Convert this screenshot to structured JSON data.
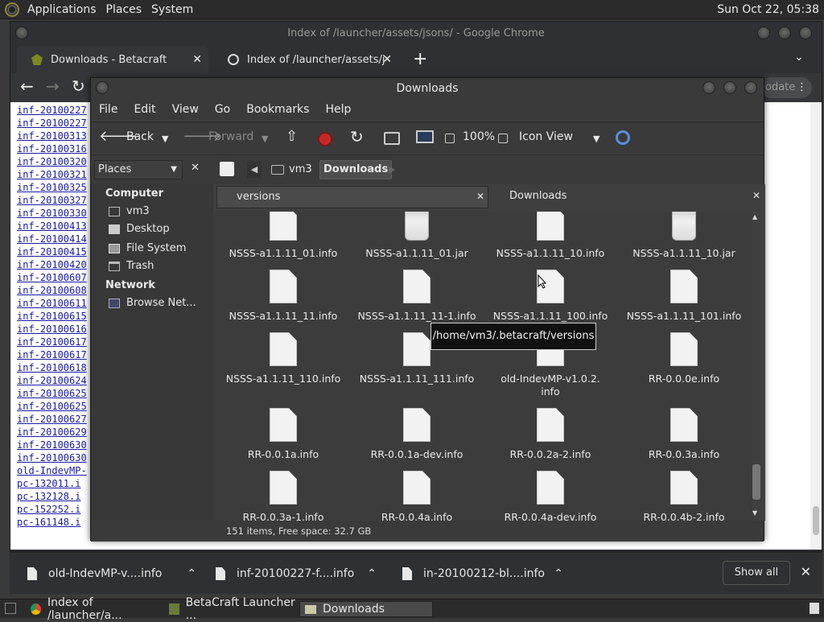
{
  "top_panel": {
    "menus": [
      "Applications",
      "Places",
      "System"
    ],
    "clock": "Sun Oct 22, 05:38"
  },
  "chrome": {
    "title": "Index of /launcher/assets/jsons/ - Google Chrome",
    "tabs": [
      {
        "label": "Downloads - Betacraft"
      },
      {
        "label": "Index of /launcher/assets/jsons"
      }
    ],
    "update_label": "odate",
    "links": [
      "inf-20100227",
      "inf-20100227",
      "inf-20100313",
      "inf-20100316",
      "inf-20100320",
      "inf-20100321",
      "inf-20100325",
      "inf-20100327",
      "inf-20100330",
      "inf-20100413",
      "inf-20100414",
      "inf-20100415",
      "inf-20100420",
      "inf-20100607",
      "inf-20100608",
      "inf-20100611",
      "inf-20100615",
      "inf-20100616",
      "inf-20100617",
      "inf-20100617",
      "inf-20100618",
      "inf-20100624",
      "inf-20100625",
      "inf-20100625",
      "inf-20100627",
      "inf-20100629",
      "inf-20100630",
      "inf-20100630",
      "old-IndevMP-",
      "pc-132011.i",
      "pc-132128.i",
      "pc-152252.i",
      "pc-161148.i"
    ]
  },
  "downloads_bar": {
    "items": [
      "old-IndevMP-v....info",
      "inf-20100227-f....info",
      "in-20100212-bl....info"
    ],
    "show_all": "Show all"
  },
  "taskbar": {
    "tasks": [
      "Index of /launcher/a...",
      "BetaCraft Launcher ...",
      "Downloads"
    ]
  },
  "nautilus": {
    "title": "Downloads",
    "menu": [
      "File",
      "Edit",
      "View",
      "Go",
      "Bookmarks",
      "Help"
    ],
    "toolbar": {
      "back": "Back",
      "forward": "Forward",
      "zoom": "100%",
      "view": "Icon View"
    },
    "sidebar_dropdown": "Places",
    "path": [
      "vm3",
      "Downloads"
    ],
    "sidebar": {
      "computer_heading": "Computer",
      "computer_items": [
        "vm3",
        "Desktop",
        "File System",
        "Trash"
      ],
      "network_heading": "Network",
      "network_items": [
        "Browse Net..."
      ]
    },
    "panes": [
      "versions",
      "Downloads"
    ],
    "tooltip": "/home/vm3/.betacraft/versions",
    "files": [
      {
        "name": "NSSS-a1.1.11_01.info",
        "type": "doc"
      },
      {
        "name": "NSSS-a1.1.11_01.jar",
        "type": "jar"
      },
      {
        "name": "NSSS-a1.1.11_10.info",
        "type": "doc"
      },
      {
        "name": "NSSS-a1.1.11_10.jar",
        "type": "jar"
      },
      {
        "name": "NSSS-a1.1.11_11.info",
        "type": "doc"
      },
      {
        "name": "NSSS-a1.1.11_11-1.info",
        "type": "doc"
      },
      {
        "name": "NSSS-a1.1.11_100.info",
        "type": "doc"
      },
      {
        "name": "NSSS-a1.1.11_101.info",
        "type": "doc"
      },
      {
        "name": "NSSS-a1.1.11_110.info",
        "type": "doc"
      },
      {
        "name": "NSSS-a1.1.11_111.info",
        "type": "doc"
      },
      {
        "name": "old-IndevMP-v1.0.2.\ninfo",
        "type": "doc"
      },
      {
        "name": "RR-0.0.0e.info",
        "type": "doc"
      },
      {
        "name": "RR-0.0.1a.info",
        "type": "doc"
      },
      {
        "name": "RR-0.0.1a-dev.info",
        "type": "doc"
      },
      {
        "name": "RR-0.0.2a-2.info",
        "type": "doc"
      },
      {
        "name": "RR-0.0.3a.info",
        "type": "doc"
      },
      {
        "name": "RR-0.0.3a-1.info",
        "type": "doc"
      },
      {
        "name": "RR-0.0.4a.info",
        "type": "doc"
      },
      {
        "name": "RR-0.0.4a-dev.info",
        "type": "doc"
      },
      {
        "name": "RR-0.0.4b-2.info",
        "type": "doc"
      }
    ],
    "status": "151 items, Free space: 32.7 GB"
  }
}
